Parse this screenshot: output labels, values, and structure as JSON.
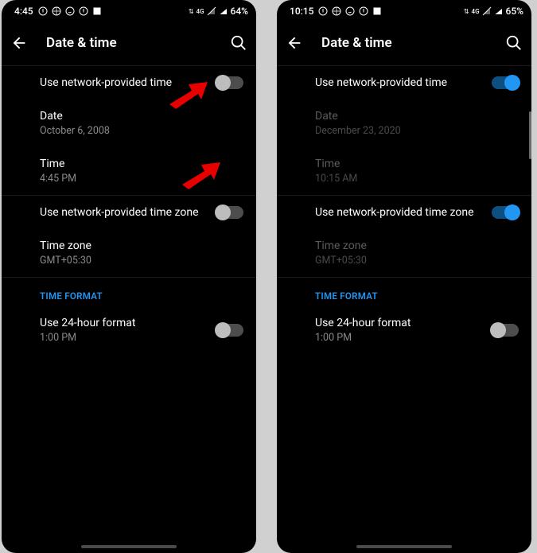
{
  "left": {
    "status": {
      "time": "4:45",
      "battery": "64%",
      "net_label": "4G"
    },
    "header": {
      "title": "Date & time"
    },
    "rows": {
      "network_time": {
        "title": "Use network-provided time",
        "on": false
      },
      "date": {
        "title": "Date",
        "value": "October 6, 2008"
      },
      "time": {
        "title": "Time",
        "value": "4:45 PM"
      },
      "network_tz": {
        "title": "Use network-provided time zone",
        "on": false
      },
      "tz": {
        "title": "Time zone",
        "value": "GMT+05:30"
      }
    },
    "section": {
      "time_format_label": "TIME FORMAT"
    },
    "hour24": {
      "title": "Use 24-hour format",
      "example": "1:00 PM",
      "on": false
    }
  },
  "right": {
    "status": {
      "time": "10:15",
      "battery": "65%",
      "net_label": "4G"
    },
    "header": {
      "title": "Date & time"
    },
    "rows": {
      "network_time": {
        "title": "Use network-provided time",
        "on": true
      },
      "date": {
        "title": "Date",
        "value": "December 23, 2020"
      },
      "time": {
        "title": "Time",
        "value": "10:15 AM"
      },
      "network_tz": {
        "title": "Use network-provided time zone",
        "on": true
      },
      "tz": {
        "title": "Time zone",
        "value": "GMT+05:30"
      }
    },
    "section": {
      "time_format_label": "TIME FORMAT"
    },
    "hour24": {
      "title": "Use 24-hour format",
      "example": "1:00 PM",
      "on": false
    }
  }
}
